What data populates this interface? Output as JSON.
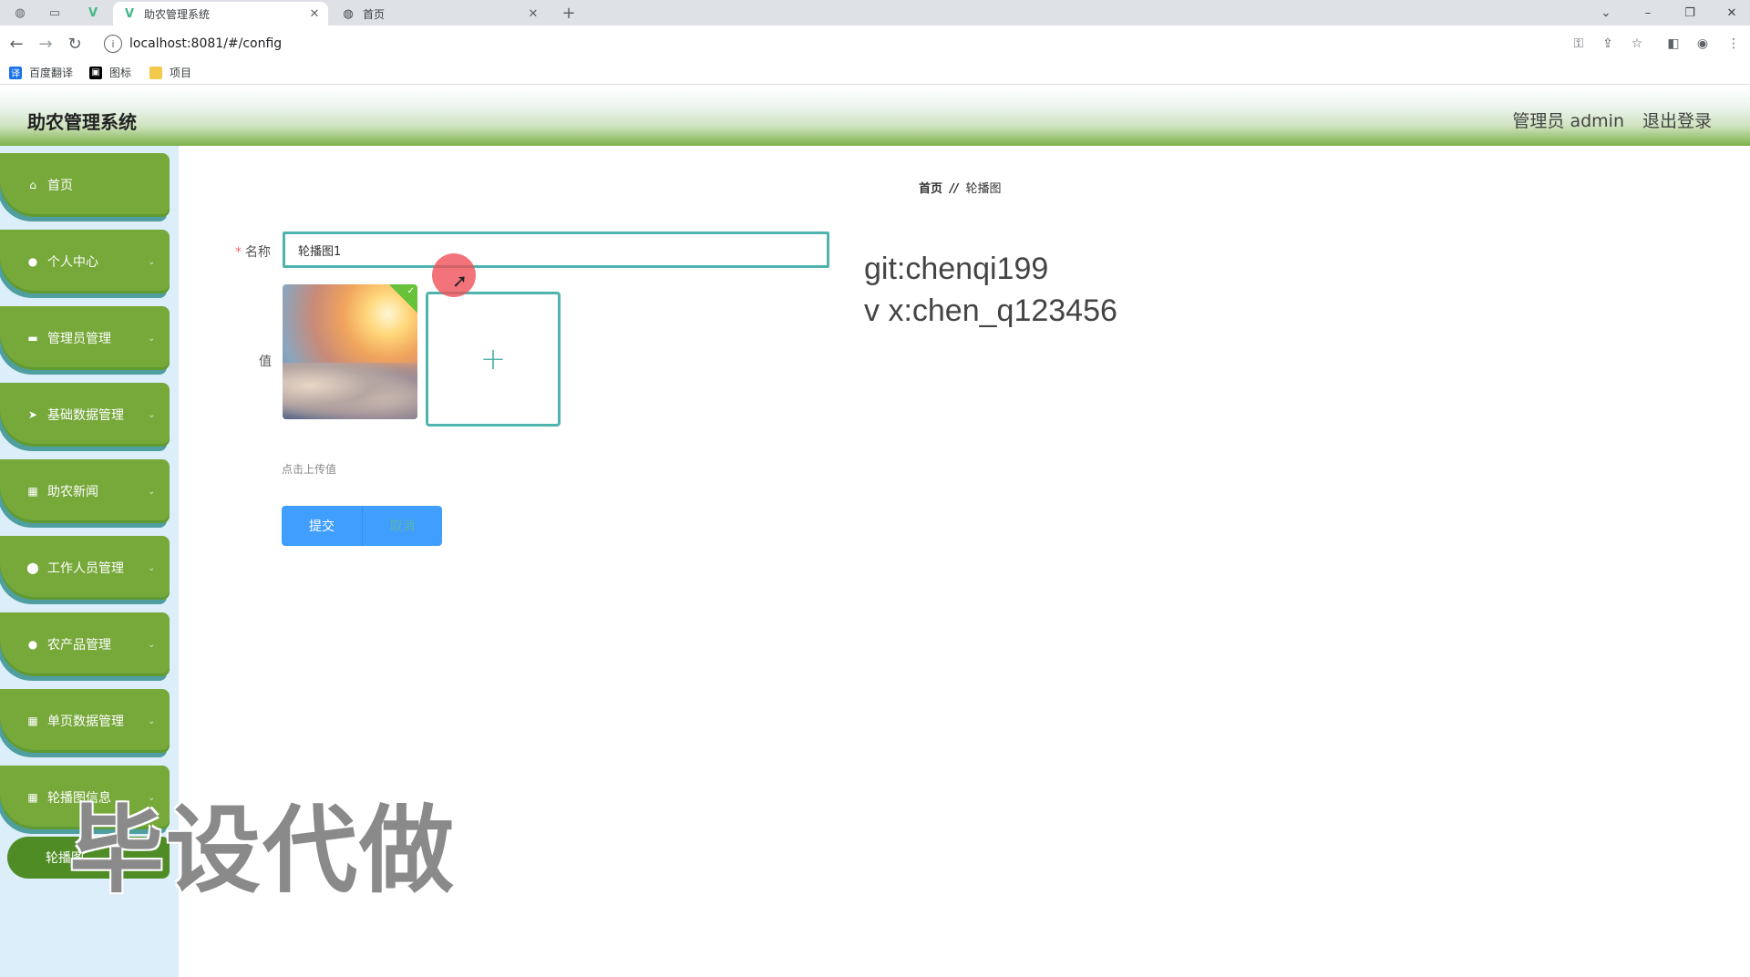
{
  "browser": {
    "tabs": [
      {
        "title": "助农管理系统",
        "active": true
      },
      {
        "title": "首页",
        "active": false
      }
    ],
    "new_tab_symbol": "+",
    "url": "localhost:8081/#/config",
    "bookmarks": [
      {
        "label": "百度翻译",
        "icon": "translate-icon",
        "color": "#1a73e8"
      },
      {
        "label": "图标",
        "icon": "image-icon",
        "color": "#000000"
      },
      {
        "label": "项目",
        "icon": "folder-icon",
        "color": "#f2c94c"
      }
    ]
  },
  "header": {
    "title": "助农管理系统",
    "admin_label": "管理员 admin",
    "logout": "退出登录"
  },
  "sidebar": {
    "items": [
      {
        "label": "首页",
        "icon": "home-icon",
        "has_chevron": false
      },
      {
        "label": "个人中心",
        "icon": "user-icon",
        "has_chevron": true
      },
      {
        "label": "管理员管理",
        "icon": "ticket-icon",
        "has_chevron": true
      },
      {
        "label": "基础数据管理",
        "icon": "send-icon",
        "has_chevron": true
      },
      {
        "label": "助农新闻",
        "icon": "grid-icon",
        "has_chevron": true
      },
      {
        "label": "工作人员管理",
        "icon": "location-icon",
        "has_chevron": true
      },
      {
        "label": "农产品管理",
        "icon": "user-icon",
        "has_chevron": true
      },
      {
        "label": "单页数据管理",
        "icon": "grid-icon",
        "has_chevron": true
      },
      {
        "label": "轮播图信息",
        "icon": "grid-icon",
        "has_chevron": true
      }
    ],
    "sub_item": {
      "label": "轮播图"
    }
  },
  "main": {
    "breadcrumb": {
      "home": "首页",
      "separator": "//",
      "current": "轮播图"
    },
    "form": {
      "name_label": "名称",
      "name_value": "轮播图1",
      "value_label": "值",
      "upload_plus": "+",
      "upload_tip": "点击上传值",
      "submit": "提交",
      "cancel": "取消"
    }
  },
  "watermark": {
    "git": "git:chenqi199",
    "wx": "v x:chen_q123456",
    "big": "毕设代做"
  },
  "colors": {
    "sidebar_item": "#76a83a",
    "accent": "#4fb3ae",
    "button": "#409eff"
  }
}
